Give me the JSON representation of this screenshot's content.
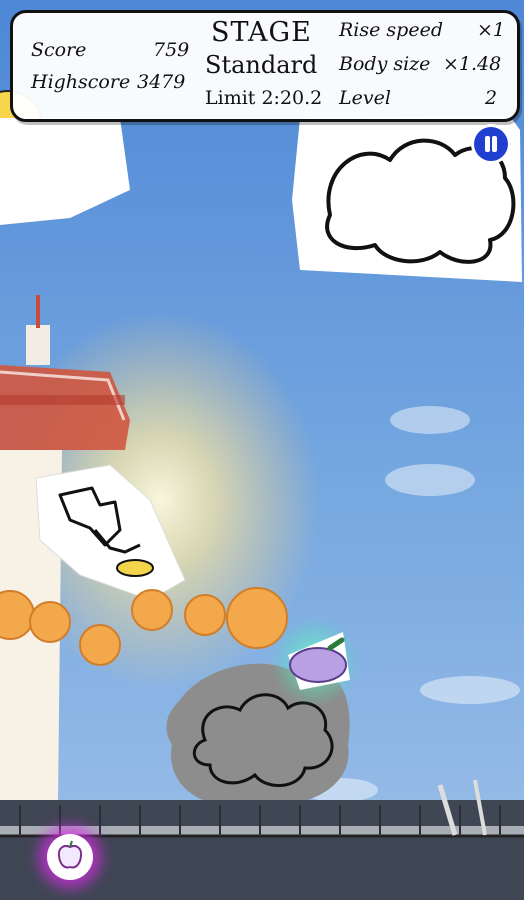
{
  "hud": {
    "score_label": "Score",
    "score_value": "759",
    "highscore_label": "Highscore",
    "highscore_value": "3479",
    "stage_label": "STAGE",
    "mode": "Standard",
    "limit": "Limit 2:20.2",
    "rise_speed_label": "Rise speed",
    "rise_speed_value": "×1",
    "body_size_label": "Body size",
    "body_size_value": "×1.48",
    "level_label": "Level",
    "level_value": "2"
  },
  "controls": {
    "pause_icon": "pause-icon",
    "powerup_icon": "apple-icon"
  },
  "colors": {
    "sky": "#6f9fd9",
    "tower": "#f7f1e6",
    "tower_red": "#c94b3b",
    "cloud_grey": "#8d8d8d",
    "puff_orange": "#f4a84c",
    "pause_blue": "#1f3fd1",
    "powerup_glow": "#d72de6"
  }
}
